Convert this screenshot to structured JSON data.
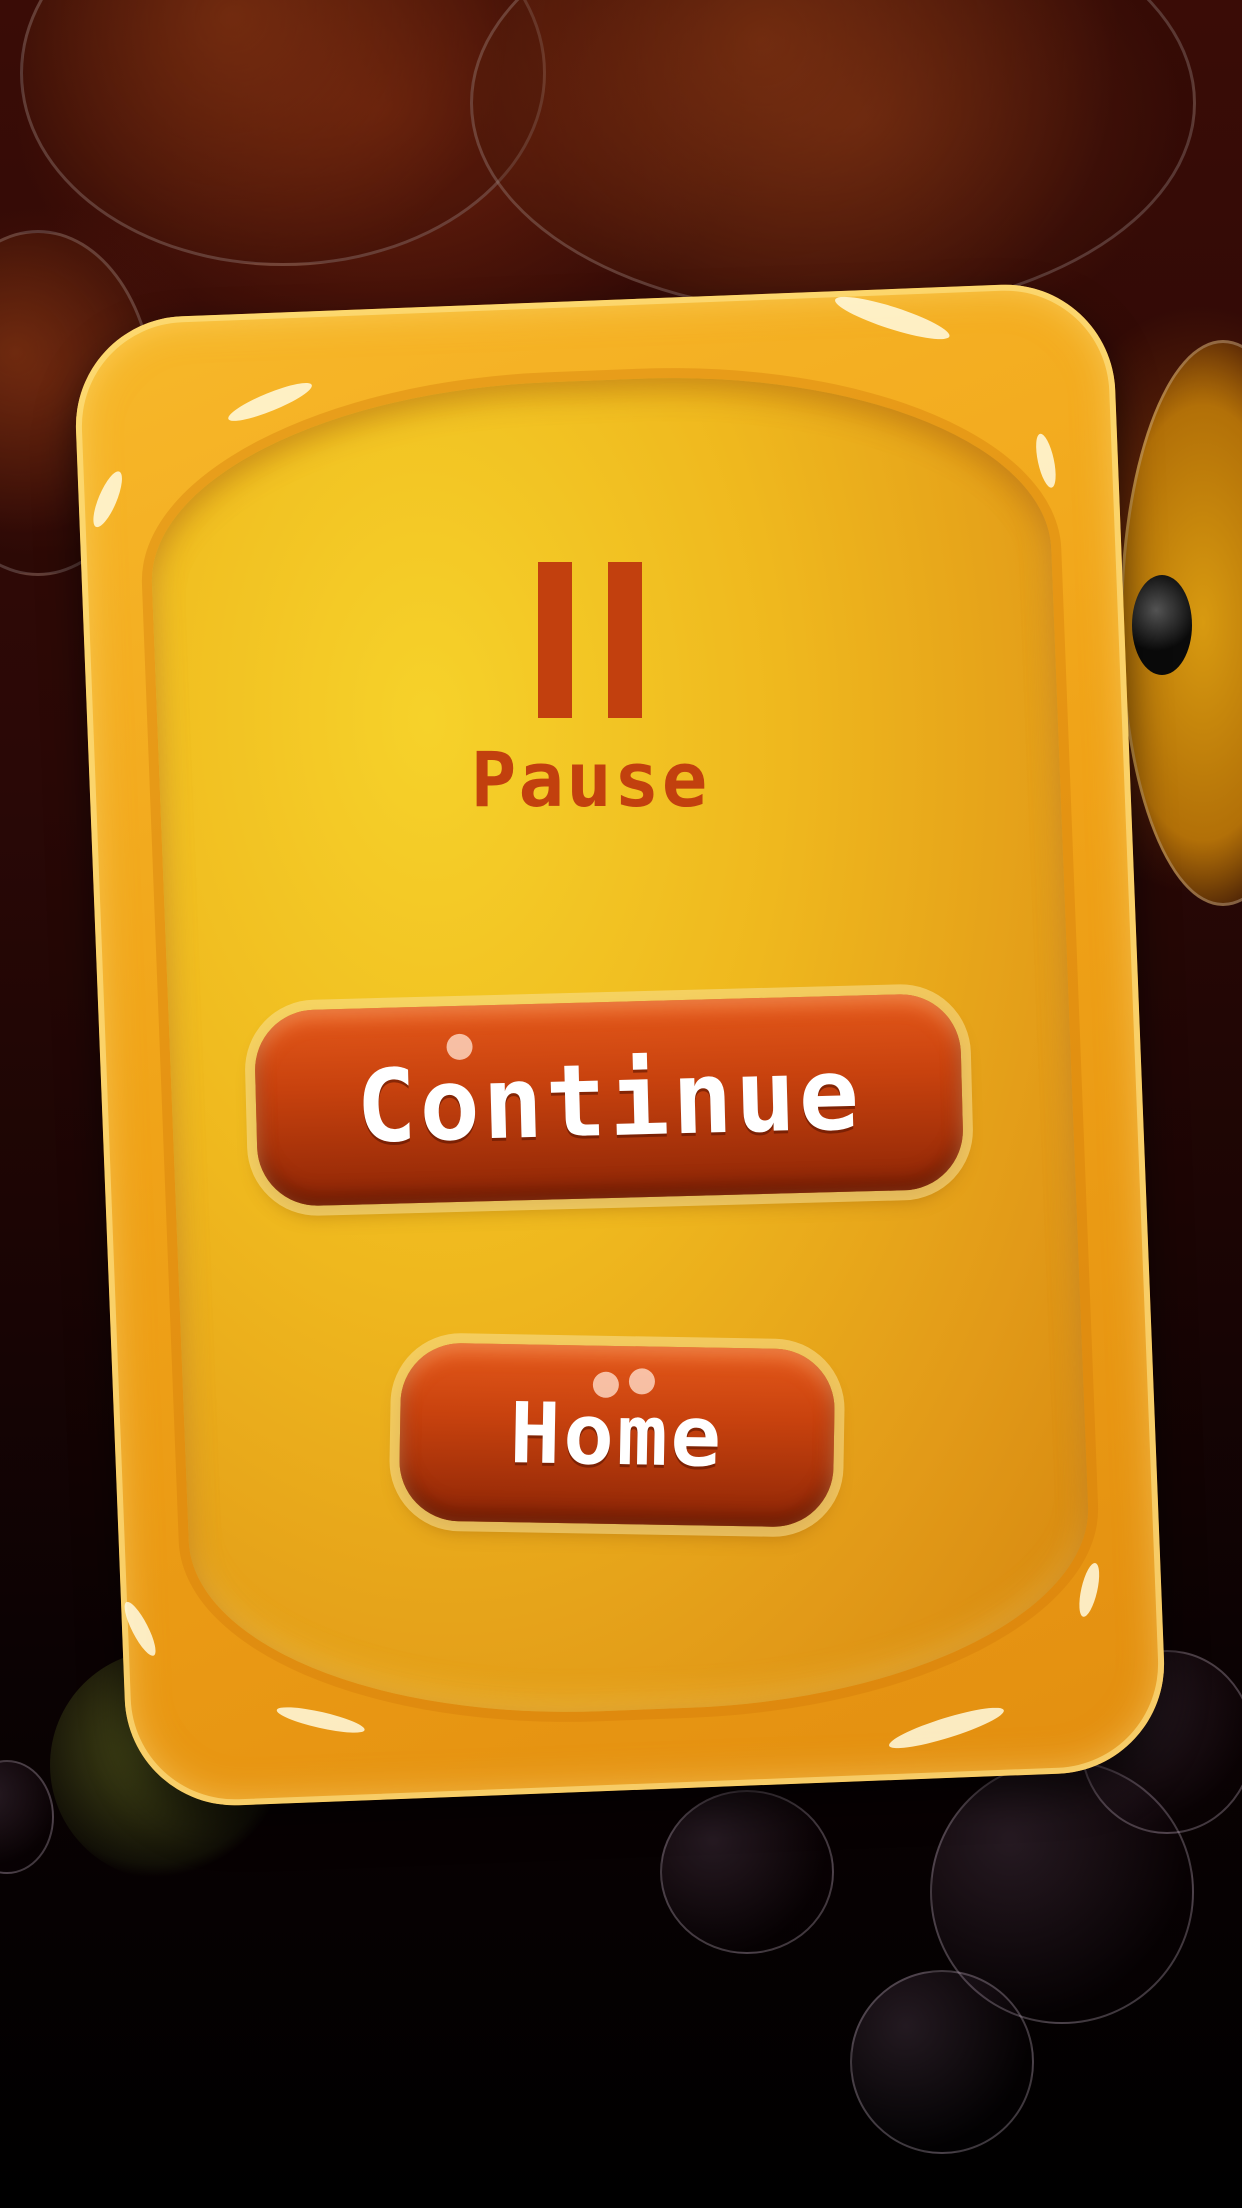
{
  "screen": "pause-menu",
  "pause": {
    "icon": "pause-icon",
    "label": "Pause"
  },
  "buttons": {
    "continue_label": "Continue",
    "home_label": "Home"
  },
  "colors": {
    "panel": "#f0a318",
    "panel_inner": "#f6d22a",
    "accent_text": "#c2400e",
    "button": "#c8420e",
    "button_text": "#ffffff",
    "background": "#1c0504"
  }
}
